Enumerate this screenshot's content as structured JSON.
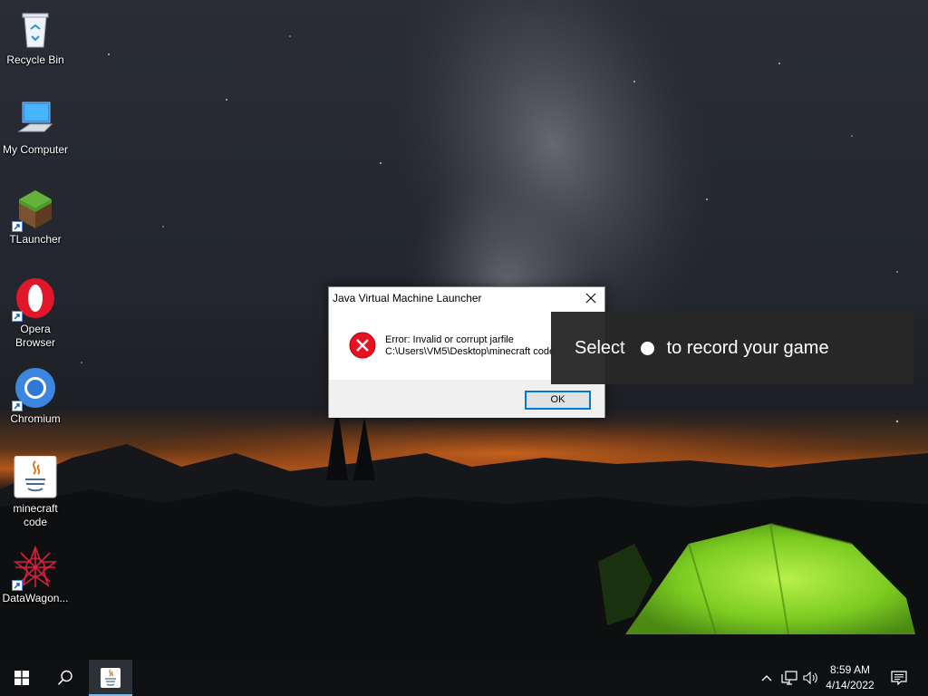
{
  "desktop": {
    "icons": [
      {
        "label": "Recycle Bin",
        "icon": "recycle-bin-icon"
      },
      {
        "label": "My Computer",
        "icon": "computer-icon"
      },
      {
        "label": "TLauncher",
        "icon": "tlauncher-icon",
        "shortcut": true
      },
      {
        "label_lines": [
          "Opera",
          "Browser"
        ],
        "icon": "opera-icon",
        "shortcut": true
      },
      {
        "label": "Chromium",
        "icon": "chromium-icon",
        "shortcut": true
      },
      {
        "label_lines": [
          "minecraft",
          "code"
        ],
        "icon": "java-jar-icon"
      },
      {
        "label": "DataWagon...",
        "icon": "datawagon-icon",
        "shortcut": true
      }
    ]
  },
  "dialog": {
    "title": "Java Virtual Machine Launcher",
    "message_line1": "Error: Invalid or corrupt jarfile",
    "message_line2": "C:\\Users\\VM5\\Desktop\\minecraft code",
    "ok_label": "OK",
    "icon": "error-icon"
  },
  "toast": {
    "before": "Select",
    "after": "to record your game"
  },
  "taskbar": {
    "start_icon": "windows-start-icon",
    "search_icon": "search-icon",
    "app_icon": "java-icon",
    "tray_icons": [
      "chevron-up-icon",
      "network-icon",
      "volume-icon"
    ],
    "time": "8:59 AM",
    "date": "4/14/2022",
    "notification_icon": "notification-icon"
  },
  "colors": {
    "accent": "#0078d7",
    "error_red": "#e81123",
    "tent_green": "#8cd62a"
  }
}
